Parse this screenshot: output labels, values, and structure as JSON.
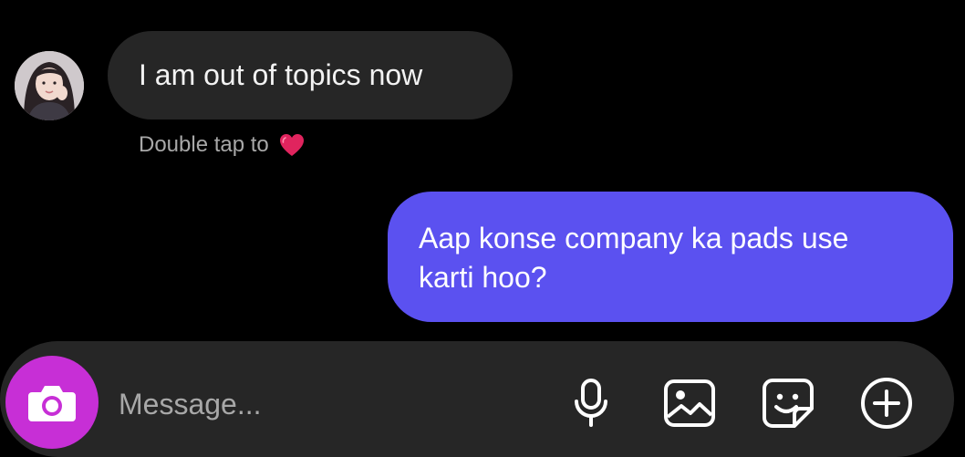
{
  "conversation": {
    "contact": {
      "avatar_icon": "profile-photo-avatar"
    },
    "messages": [
      {
        "direction": "incoming",
        "text": "I am out of topics now",
        "hint_text": "Double tap to",
        "hint_icon": "heart-icon"
      },
      {
        "direction": "outgoing",
        "line1": "Aap konse company ka pads use",
        "line2": "karti hoo?"
      }
    ]
  },
  "composer": {
    "placeholder": "Message...",
    "camera_icon": "camera-icon",
    "tools": [
      "microphone-icon",
      "gallery-icon",
      "sticker-icon",
      "add-icon"
    ]
  },
  "colors": {
    "background": "#000000",
    "incoming_bubble": "#262626",
    "outgoing_bubble": "#5b51f0",
    "camera_button": "#c72fd6",
    "heart": "#e0245e"
  }
}
